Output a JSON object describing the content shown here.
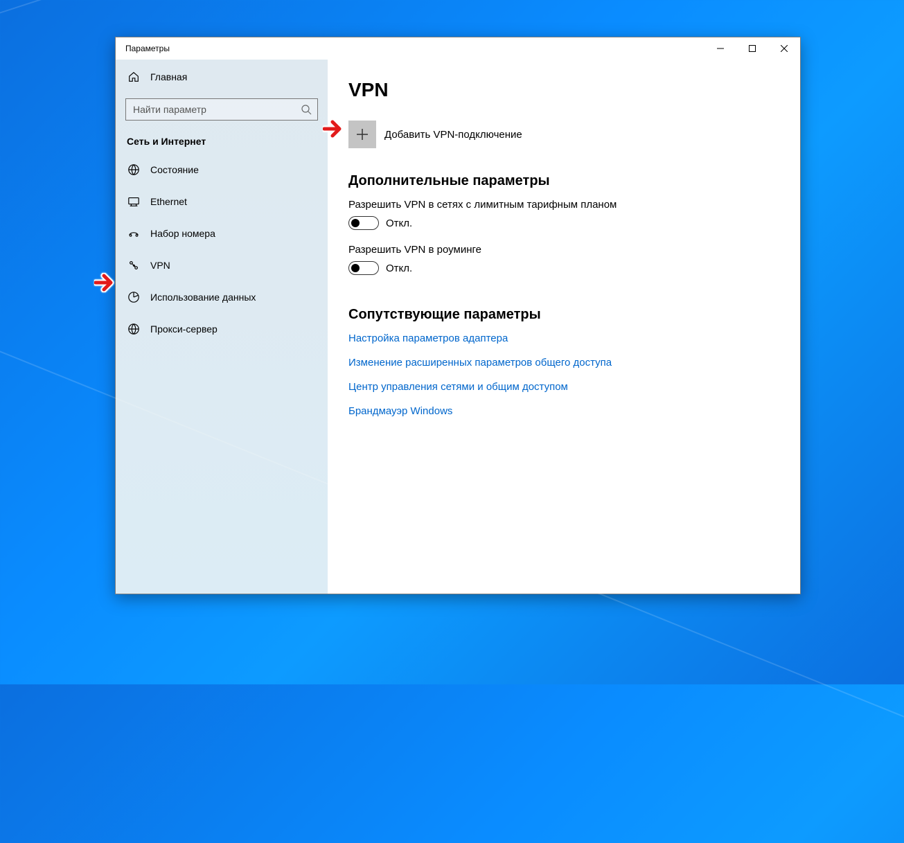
{
  "window": {
    "title": "Параметры"
  },
  "sidebar": {
    "home": "Главная",
    "search_placeholder": "Найти параметр",
    "group": "Сеть и Интернет",
    "items": [
      {
        "id": "status",
        "label": "Состояние"
      },
      {
        "id": "ethernet",
        "label": "Ethernet"
      },
      {
        "id": "dialup",
        "label": "Набор номера"
      },
      {
        "id": "vpn",
        "label": "VPN"
      },
      {
        "id": "data",
        "label": "Использование данных"
      },
      {
        "id": "proxy",
        "label": "Прокси-сервер"
      }
    ]
  },
  "main": {
    "heading": "VPN",
    "add_label": "Добавить VPN-подключение",
    "advanced_heading": "Дополнительные параметры",
    "setting_metered": {
      "label": "Разрешить VPN в сетях с лимитным тарифным планом",
      "state": "Откл."
    },
    "setting_roaming": {
      "label": "Разрешить VPN в роуминге",
      "state": "Откл."
    },
    "related_heading": "Сопутствующие параметры",
    "links": [
      "Настройка параметров адаптера",
      "Изменение расширенных параметров общего доступа",
      "Центр управления сетями и общим доступом",
      "Брандмауэр Windows"
    ]
  }
}
